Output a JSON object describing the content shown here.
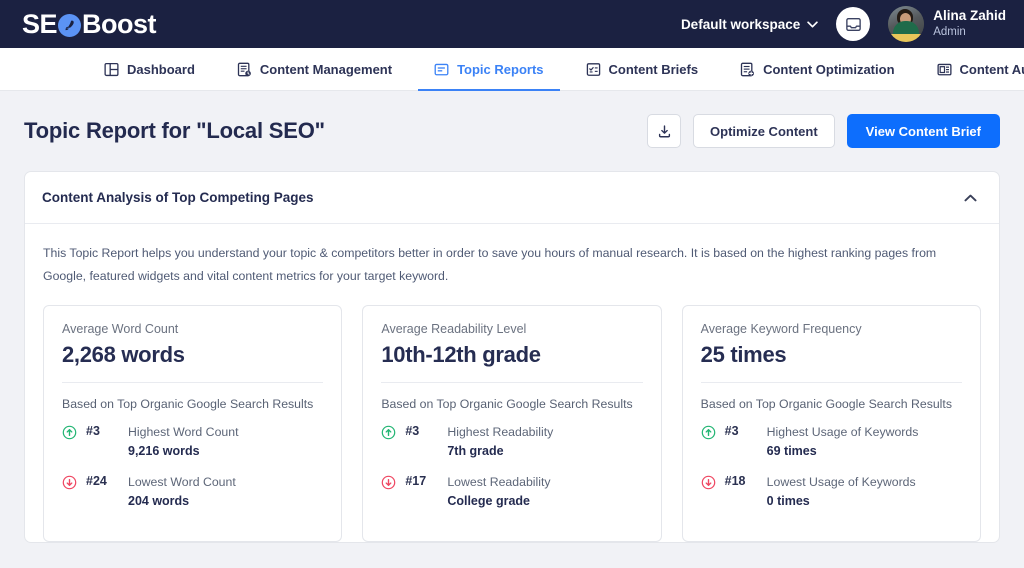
{
  "brand": {
    "name_part1": "SE",
    "name_part2": "Boost",
    "logo_icon": "rocket-circle-icon",
    "accent_blue": "#5b93f5",
    "header_bg": "#1b2141"
  },
  "header": {
    "workspace_label": "Default workspace",
    "workspace_caret": "chevron-down-icon",
    "inbox_icon": "inbox-tray-icon",
    "user_name": "Alina Zahid",
    "user_role": "Admin",
    "avatar": "user-avatar-photo"
  },
  "nav": {
    "items": [
      {
        "label": "Dashboard",
        "icon": "layout-dashboard-icon",
        "active": false
      },
      {
        "label": "Content Management",
        "icon": "document-clock-icon",
        "active": false
      },
      {
        "label": "Topic Reports",
        "icon": "report-folder-icon",
        "active": true
      },
      {
        "label": "Content Briefs",
        "icon": "document-check-icon",
        "active": false
      },
      {
        "label": "Content Optimization",
        "icon": "document-plus-icon",
        "active": false
      },
      {
        "label": "Content Audits",
        "icon": "document-list-icon",
        "active": false
      }
    ],
    "active_color": "#3b82f6"
  },
  "page": {
    "title": "Topic Report for \"Local SEO\"",
    "actions": {
      "download_icon": "download-icon",
      "secondary_label": "Optimize Content",
      "primary_label": "View Content Brief",
      "primary_color": "#0d6efd"
    }
  },
  "analysis_card": {
    "title": "Content Analysis of Top Competing Pages",
    "collapse_icon": "chevron-up-icon",
    "description": "This Topic Report helps you understand your topic & competitors better in order to save you hours of manual research. It is based on the highest ranking pages from Google, featured widgets and vital content metrics for your target keyword.",
    "subtitle_common": "Based on Top Organic Google Search Results",
    "up_color": "#22b573",
    "down_color": "#ef4661",
    "metrics": [
      {
        "label": "Average Word Count",
        "value": "2,268 words",
        "subtitle": "Based on Top Organic Google Search Results",
        "stats": [
          {
            "direction": "up",
            "icon": "arrow-up-circle-icon",
            "rank": "#3",
            "name": "Highest Word Count",
            "value": "9,216 words"
          },
          {
            "direction": "down",
            "icon": "arrow-down-circle-icon",
            "rank": "#24",
            "name": "Lowest Word Count",
            "value": "204 words"
          }
        ]
      },
      {
        "label": "Average Readability Level",
        "value": "10th-12th grade",
        "subtitle": "Based on Top Organic Google Search Results",
        "stats": [
          {
            "direction": "up",
            "icon": "arrow-up-circle-icon",
            "rank": "#3",
            "name": "Highest Readability",
            "value": "7th grade"
          },
          {
            "direction": "down",
            "icon": "arrow-down-circle-icon",
            "rank": "#17",
            "name": "Lowest Readability",
            "value": "College grade"
          }
        ]
      },
      {
        "label": "Average Keyword Frequency",
        "value": "25 times",
        "subtitle": "Based on Top Organic Google Search Results",
        "stats": [
          {
            "direction": "up",
            "icon": "arrow-up-circle-icon",
            "rank": "#3",
            "name": "Highest Usage of Keywords",
            "value": "69 times"
          },
          {
            "direction": "down",
            "icon": "arrow-down-circle-icon",
            "rank": "#18",
            "name": "Lowest Usage of Keywords",
            "value": "0 times"
          }
        ]
      }
    ]
  }
}
